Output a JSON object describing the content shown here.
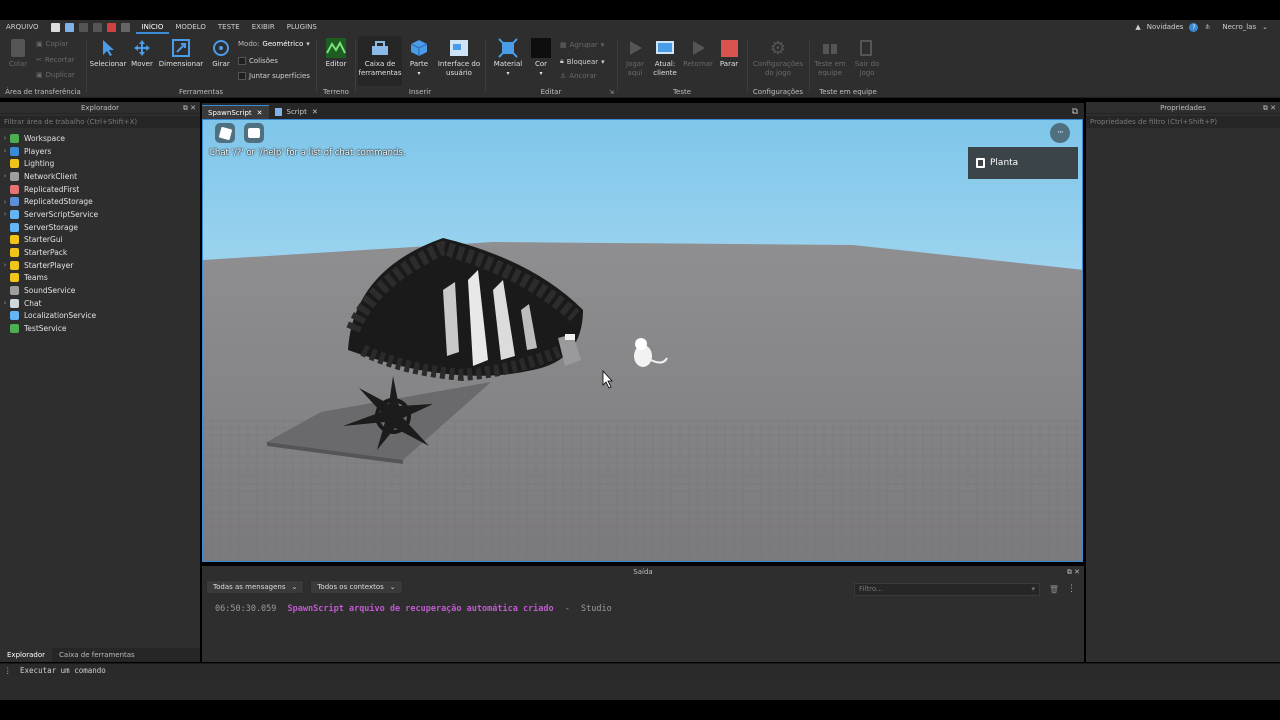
{
  "menu": {
    "file": "ARQUIVO",
    "tabs": [
      "INÍCIO",
      "MODELO",
      "TESTE",
      "EXIBIR",
      "PLUGINS"
    ],
    "active_tab": "INÍCIO",
    "news": "Novidades",
    "user": "Necro_las"
  },
  "ribbon": {
    "clipboard": {
      "paste": "Colar",
      "copy": "Copiar",
      "cut": "Recortar",
      "duplicate": "Duplicar",
      "label": "Área de transferência"
    },
    "tools": {
      "select": "Selecionar",
      "move": "Mover",
      "scale": "Dimensionar",
      "rotate": "Girar",
      "mode_label": "Modo:",
      "mode_value": "Geométrico",
      "collisions": "Colisões",
      "join": "Juntar superfícies",
      "label": "Ferramentas"
    },
    "terrain": {
      "editor": "Editor",
      "label": "Terreno"
    },
    "insert": {
      "toolbox": "Caixa de ferramentas",
      "part": "Parte",
      "ui": "Interface do usuário",
      "label": "Inserir"
    },
    "edit": {
      "material": "Material",
      "color": "Cor",
      "group": "Agrupar",
      "lock": "Bloquear",
      "anchor": "Ancorar",
      "label": "Editar"
    },
    "test": {
      "play": "Jogar aqui",
      "current": "Atual: cliente",
      "resume": "Retomar",
      "stop": "Parar",
      "label": "Teste"
    },
    "settings": {
      "game_settings": "Configurações do jogo",
      "label": "Configurações"
    },
    "team": {
      "team_test": "Teste em equipe",
      "exit_game": "Sair do jogo",
      "label": "Teste em equipe"
    }
  },
  "explorer": {
    "title": "Explorador",
    "filter_placeholder": "Filtrar área de trabalho (Ctrl+Shift+X)",
    "items": [
      {
        "label": "Workspace",
        "expandable": true,
        "color": "#4caf50"
      },
      {
        "label": "Players",
        "expandable": true,
        "color": "#3a8bd6"
      },
      {
        "label": "Lighting",
        "expandable": false,
        "color": "#f0c419"
      },
      {
        "label": "NetworkClient",
        "expandable": true,
        "color": "#9e9e9e"
      },
      {
        "label": "ReplicatedFirst",
        "expandable": false,
        "color": "#e57373"
      },
      {
        "label": "ReplicatedStorage",
        "expandable": true,
        "color": "#5c8fd6"
      },
      {
        "label": "ServerScriptService",
        "expandable": true,
        "color": "#64b5f6"
      },
      {
        "label": "ServerStorage",
        "expandable": false,
        "color": "#64b5f6"
      },
      {
        "label": "StarterGui",
        "expandable": false,
        "color": "#f0c419"
      },
      {
        "label": "StarterPack",
        "expandable": false,
        "color": "#f0c419"
      },
      {
        "label": "StarterPlayer",
        "expandable": true,
        "color": "#f0c419"
      },
      {
        "label": "Teams",
        "expandable": false,
        "color": "#f0c419"
      },
      {
        "label": "SoundService",
        "expandable": false,
        "color": "#9e9e9e"
      },
      {
        "label": "Chat",
        "expandable": true,
        "color": "#cfd8dc"
      },
      {
        "label": "LocalizationService",
        "expandable": false,
        "color": "#64b5f6"
      },
      {
        "label": "TestService",
        "expandable": false,
        "color": "#4caf50"
      }
    ],
    "bottom_tabs": [
      "Explorador",
      "Caixa de ferramentas"
    ]
  },
  "documents": {
    "tabs": [
      "SpawnScript",
      "Script"
    ]
  },
  "viewport": {
    "chat_hint": "Chat '/?' or '/help' for a list of chat commands.",
    "planta": "Planta"
  },
  "output": {
    "title": "Saída",
    "messages_filter": "Todas as mensagens",
    "contexts_filter": "Todos os contextos",
    "filter_placeholder": "Filtro...",
    "line": {
      "time": "06:50:30.059",
      "message": "SpawnScript arquivo de recuperação automática criado",
      "dash": "-",
      "source": "Studio"
    }
  },
  "properties": {
    "title": "Propriedades",
    "filter_placeholder": "Propriedades de filtro (Ctrl+Shift+P)"
  },
  "command": {
    "placeholder": "Executar um comando"
  }
}
